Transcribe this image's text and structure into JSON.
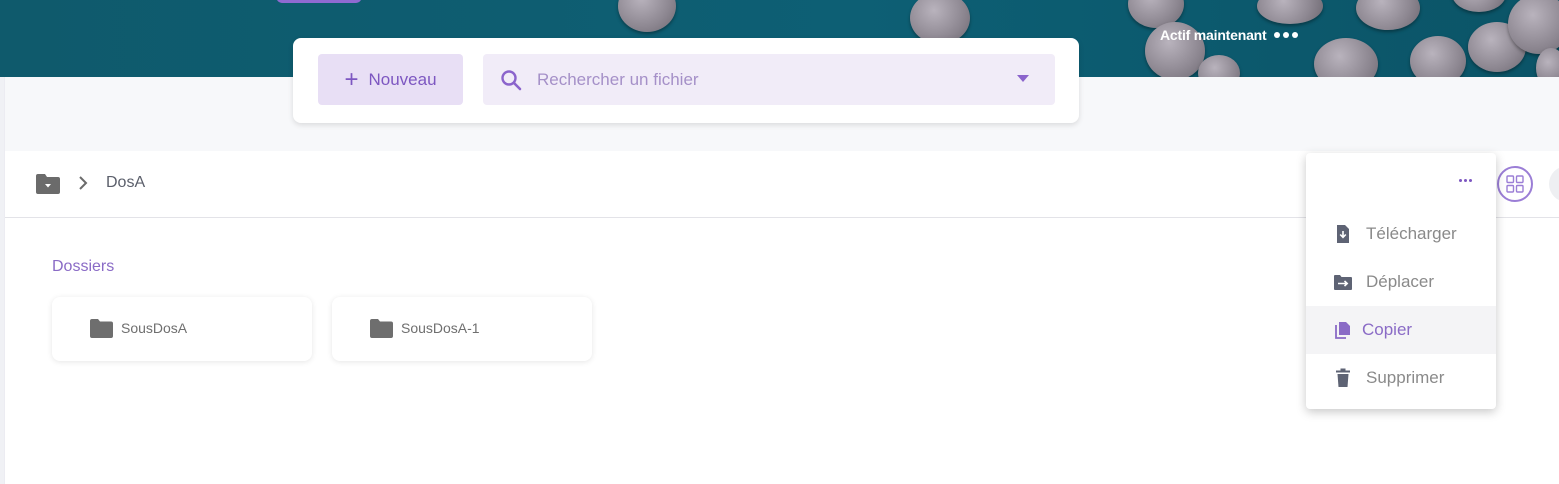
{
  "header": {
    "status_label": "Actif maintenant"
  },
  "toolbar": {
    "new_label": "Nouveau",
    "search_placeholder": "Rechercher un fichier"
  },
  "breadcrumb": {
    "current": "DosA"
  },
  "content": {
    "section_title": "Dossiers",
    "folders": [
      {
        "name": "SousDosA"
      },
      {
        "name": "SousDosA-1"
      }
    ]
  },
  "context_menu": {
    "items": [
      {
        "label": "Télécharger",
        "icon": "file-download-icon"
      },
      {
        "label": "Déplacer",
        "icon": "folder-move-icon"
      },
      {
        "label": "Copier",
        "icon": "copy-icon",
        "highlighted": true
      },
      {
        "label": "Supprimer",
        "icon": "trash-icon"
      }
    ]
  },
  "colors": {
    "accent": "#8a6bc6",
    "banner": "#0e5b70",
    "button_bg": "#e8dff5",
    "search_bg": "#f1ecf8"
  }
}
